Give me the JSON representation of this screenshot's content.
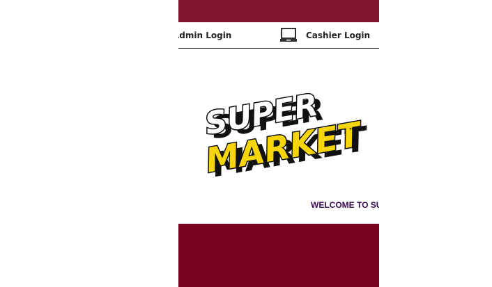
{
  "colors": {
    "top_band": "#841532",
    "bottom_band": "#7a0020",
    "logo_yellow": "#f6d60a",
    "logo_black": "#111111",
    "welcome_text": "#3a0a52"
  },
  "nav": {
    "admin_label": "Admin Login",
    "cashier_label": "Cashier Login",
    "cashier_icon": "computer-icon"
  },
  "logo": {
    "line1": "SUPER",
    "line2": "MARKET",
    "tm": "™"
  },
  "welcome": {
    "text": "WELCOME TO SUPERMARKET"
  }
}
